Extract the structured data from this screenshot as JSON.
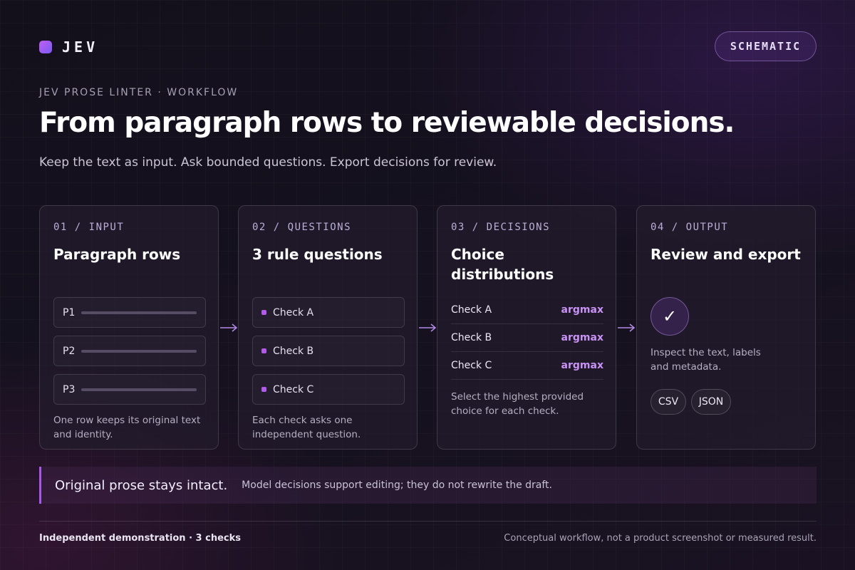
{
  "brand": {
    "name": "JEV",
    "icon": "gradient-square-logo"
  },
  "badge": "SCHEMATIC",
  "header": {
    "kicker": "JEV PROSE LINTER · WORKFLOW",
    "title": "From paragraph rows to reviewable decisions.",
    "subtitle": "Keep the text as input. Ask bounded questions. Export decisions for review."
  },
  "cards": {
    "input": {
      "step": "01 / INPUT",
      "title": "Paragraph rows",
      "rows": [
        "P1",
        "P2",
        "P3"
      ],
      "note": "One row keeps its original text and identity."
    },
    "questions": {
      "step": "02 / QUESTIONS",
      "title": "3 rule questions",
      "checks": [
        "Check A",
        "Check B",
        "Check C"
      ],
      "note": "Each check asks one independent question."
    },
    "decisions": {
      "step": "03 / DECISIONS",
      "title": "Choice distributions",
      "rows": [
        {
          "label": "Check A",
          "value": "argmax"
        },
        {
          "label": "Check B",
          "value": "argmax"
        },
        {
          "label": "Check C",
          "value": "argmax"
        }
      ],
      "note": "Select the highest provided choice for each check."
    },
    "output": {
      "step": "04 / OUTPUT",
      "title": "Review and export",
      "check_icon": "checkmark-icon",
      "check_glyph": "✓",
      "note": "Inspect the text, labels and metadata.",
      "formats": [
        "CSV",
        "JSON"
      ]
    }
  },
  "callout": {
    "strong": "Original prose stays intact.",
    "text": "Model decisions support editing; they do not rewrite the draft."
  },
  "footer": {
    "left": "Independent demonstration · 3 checks",
    "right": "Conceptual workflow, not a product screenshot or measured result."
  },
  "colors": {
    "accent": "#a559e6",
    "accent_value": "#c992f5",
    "background": "#15111e"
  }
}
